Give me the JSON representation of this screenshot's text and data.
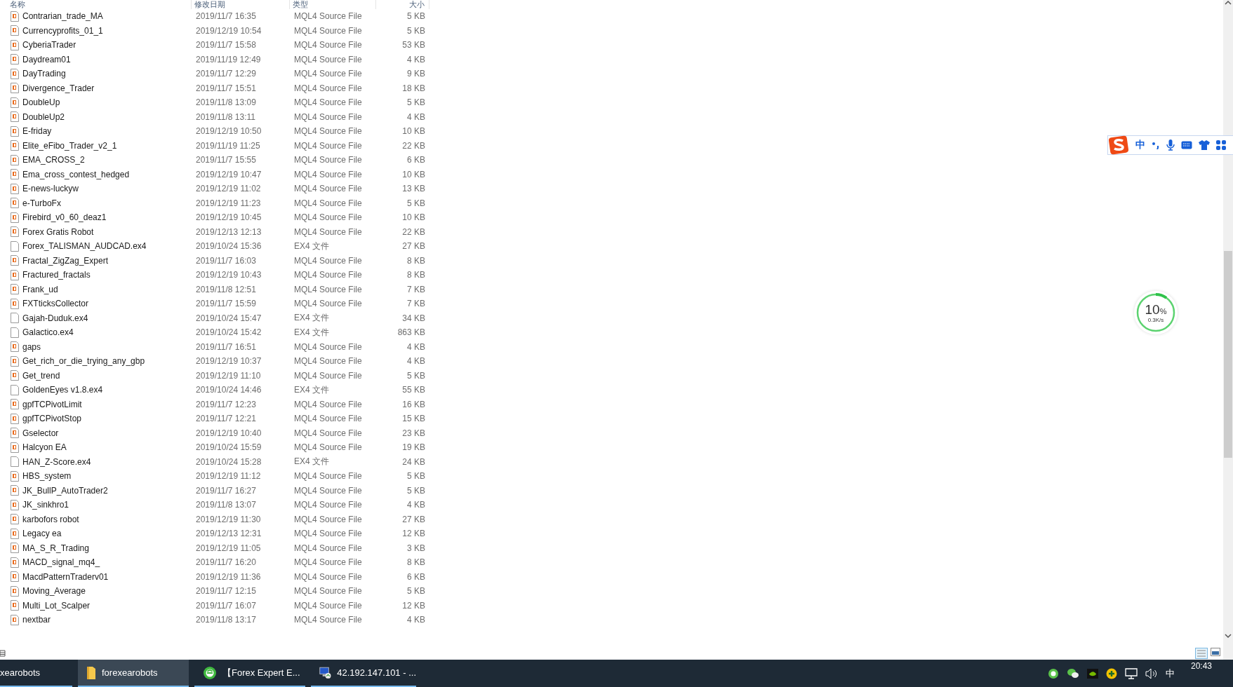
{
  "columns": [
    {
      "label": "名称",
      "kind": "name"
    },
    {
      "label": "修改日期",
      "kind": "date"
    },
    {
      "label": "类型",
      "kind": "type"
    },
    {
      "label": "大小",
      "kind": "size"
    }
  ],
  "files": [
    {
      "name": "Contrarian_trade_MA",
      "modified": "2019/11/7 16:35",
      "type": "MQL4 Source File",
      "size": "5 KB",
      "kind": "mql4"
    },
    {
      "name": "Currencyprofits_01_1",
      "modified": "2019/12/19 10:54",
      "type": "MQL4 Source File",
      "size": "5 KB",
      "kind": "mql4"
    },
    {
      "name": "CyberiaTrader",
      "modified": "2019/11/7 15:58",
      "type": "MQL4 Source File",
      "size": "53 KB",
      "kind": "mql4"
    },
    {
      "name": "Daydream01",
      "modified": "2019/11/19 12:49",
      "type": "MQL4 Source File",
      "size": "4 KB",
      "kind": "mql4"
    },
    {
      "name": "DayTrading",
      "modified": "2019/11/7 12:29",
      "type": "MQL4 Source File",
      "size": "9 KB",
      "kind": "mql4"
    },
    {
      "name": "Divergence_Trader",
      "modified": "2019/11/7 15:51",
      "type": "MQL4 Source File",
      "size": "18 KB",
      "kind": "mql4"
    },
    {
      "name": "DoubleUp",
      "modified": "2019/11/8 13:09",
      "type": "MQL4 Source File",
      "size": "5 KB",
      "kind": "mql4"
    },
    {
      "name": "DoubleUp2",
      "modified": "2019/11/8 13:11",
      "type": "MQL4 Source File",
      "size": "4 KB",
      "kind": "mql4"
    },
    {
      "name": "E-friday",
      "modified": "2019/12/19 10:50",
      "type": "MQL4 Source File",
      "size": "10 KB",
      "kind": "mql4"
    },
    {
      "name": "Elite_eFibo_Trader_v2_1",
      "modified": "2019/11/19 11:25",
      "type": "MQL4 Source File",
      "size": "22 KB",
      "kind": "mql4"
    },
    {
      "name": "EMA_CROSS_2",
      "modified": "2019/11/7 15:55",
      "type": "MQL4 Source File",
      "size": "6 KB",
      "kind": "mql4"
    },
    {
      "name": "Ema_cross_contest_hedged",
      "modified": "2019/12/19 10:47",
      "type": "MQL4 Source File",
      "size": "10 KB",
      "kind": "mql4"
    },
    {
      "name": "E-news-luckyw",
      "modified": "2019/12/19 11:02",
      "type": "MQL4 Source File",
      "size": "13 KB",
      "kind": "mql4"
    },
    {
      "name": "e-TurboFx",
      "modified": "2019/12/19 11:23",
      "type": "MQL4 Source File",
      "size": "5 KB",
      "kind": "mql4"
    },
    {
      "name": "Firebird_v0_60_deaz1",
      "modified": "2019/12/19 10:45",
      "type": "MQL4 Source File",
      "size": "10 KB",
      "kind": "mql4"
    },
    {
      "name": "Forex Gratis Robot",
      "modified": "2019/12/13 12:13",
      "type": "MQL4 Source File",
      "size": "22 KB",
      "kind": "mql4"
    },
    {
      "name": "Forex_TALISMAN_AUDCAD.ex4",
      "modified": "2019/10/24 15:36",
      "type": "EX4 文件",
      "size": "27 KB",
      "kind": "ex4"
    },
    {
      "name": "Fractal_ZigZag_Expert",
      "modified": "2019/11/7 16:03",
      "type": "MQL4 Source File",
      "size": "8 KB",
      "kind": "mql4"
    },
    {
      "name": "Fractured_fractals",
      "modified": "2019/12/19 10:43",
      "type": "MQL4 Source File",
      "size": "8 KB",
      "kind": "mql4"
    },
    {
      "name": "Frank_ud",
      "modified": "2019/11/8 12:51",
      "type": "MQL4 Source File",
      "size": "7 KB",
      "kind": "mql4"
    },
    {
      "name": "FXTticksCollector",
      "modified": "2019/11/7 15:59",
      "type": "MQL4 Source File",
      "size": "7 KB",
      "kind": "mql4"
    },
    {
      "name": "Gajah-Duduk.ex4",
      "modified": "2019/10/24 15:47",
      "type": "EX4 文件",
      "size": "34 KB",
      "kind": "ex4"
    },
    {
      "name": "Galactico.ex4",
      "modified": "2019/10/24 15:42",
      "type": "EX4 文件",
      "size": "863 KB",
      "kind": "ex4"
    },
    {
      "name": "gaps",
      "modified": "2019/11/7 16:51",
      "type": "MQL4 Source File",
      "size": "4 KB",
      "kind": "mql4"
    },
    {
      "name": "Get_rich_or_die_trying_any_gbp",
      "modified": "2019/12/19 10:37",
      "type": "MQL4 Source File",
      "size": "4 KB",
      "kind": "mql4"
    },
    {
      "name": "Get_trend",
      "modified": "2019/12/19 11:10",
      "type": "MQL4 Source File",
      "size": "5 KB",
      "kind": "mql4"
    },
    {
      "name": "GoldenEyes v1.8.ex4",
      "modified": "2019/10/24 14:46",
      "type": "EX4 文件",
      "size": "55 KB",
      "kind": "ex4"
    },
    {
      "name": "gpfTCPivotLimit",
      "modified": "2019/11/7 12:23",
      "type": "MQL4 Source File",
      "size": "16 KB",
      "kind": "mql4"
    },
    {
      "name": "gpfTCPivotStop",
      "modified": "2019/11/7 12:21",
      "type": "MQL4 Source File",
      "size": "15 KB",
      "kind": "mql4"
    },
    {
      "name": "Gselector",
      "modified": "2019/12/19 10:40",
      "type": "MQL4 Source File",
      "size": "23 KB",
      "kind": "mql4"
    },
    {
      "name": "Halcyon EA",
      "modified": "2019/10/24 15:59",
      "type": "MQL4 Source File",
      "size": "19 KB",
      "kind": "mql4"
    },
    {
      "name": "HAN_Z-Score.ex4",
      "modified": "2019/10/24 15:28",
      "type": "EX4 文件",
      "size": "24 KB",
      "kind": "ex4"
    },
    {
      "name": "HBS_system",
      "modified": "2019/12/19 11:12",
      "type": "MQL4 Source File",
      "size": "5 KB",
      "kind": "mql4"
    },
    {
      "name": "JK_BullP_AutoTrader2",
      "modified": "2019/11/7 16:27",
      "type": "MQL4 Source File",
      "size": "5 KB",
      "kind": "mql4"
    },
    {
      "name": "JK_sinkhro1",
      "modified": "2019/11/8 13:07",
      "type": "MQL4 Source File",
      "size": "4 KB",
      "kind": "mql4"
    },
    {
      "name": "karbofors robot",
      "modified": "2019/12/19 11:30",
      "type": "MQL4 Source File",
      "size": "27 KB",
      "kind": "mql4"
    },
    {
      "name": "Legacy ea",
      "modified": "2019/12/13 12:31",
      "type": "MQL4 Source File",
      "size": "12 KB",
      "kind": "mql4"
    },
    {
      "name": "MA_S_R_Trading",
      "modified": "2019/12/19 11:05",
      "type": "MQL4 Source File",
      "size": "3 KB",
      "kind": "mql4"
    },
    {
      "name": "MACD_signal_mq4_",
      "modified": "2019/11/7 16:20",
      "type": "MQL4 Source File",
      "size": "8 KB",
      "kind": "mql4"
    },
    {
      "name": "MacdPatternTraderv01",
      "modified": "2019/12/19 11:36",
      "type": "MQL4 Source File",
      "size": "6 KB",
      "kind": "mql4"
    },
    {
      "name": "Moving_Average",
      "modified": "2019/11/7 12:15",
      "type": "MQL4 Source File",
      "size": "5 KB",
      "kind": "mql4"
    },
    {
      "name": "Multi_Lot_Scalper",
      "modified": "2019/11/7 16:07",
      "type": "MQL4 Source File",
      "size": "12 KB",
      "kind": "mql4"
    },
    {
      "name": "nextbar",
      "modified": "2019/11/8 13:17",
      "type": "MQL4 Source File",
      "size": "4 KB",
      "kind": "mql4"
    }
  ],
  "ime_toolbar": {
    "mode": "中"
  },
  "speed_widget": {
    "percent": "10",
    "unit": "%",
    "rate": "0.3K/s"
  },
  "taskbar": {
    "items": [
      {
        "label": "xearobots",
        "selected": false,
        "kind": "none"
      },
      {
        "label": "forexearobots",
        "selected": true,
        "kind": "folder"
      },
      {
        "label": "【Forex Expert E...",
        "selected": false,
        "kind": "browser"
      },
      {
        "label": "42.192.147.101 - ...",
        "selected": false,
        "kind": "remote"
      }
    ],
    "tray": {
      "ime": "中",
      "clock": "20:43"
    }
  }
}
